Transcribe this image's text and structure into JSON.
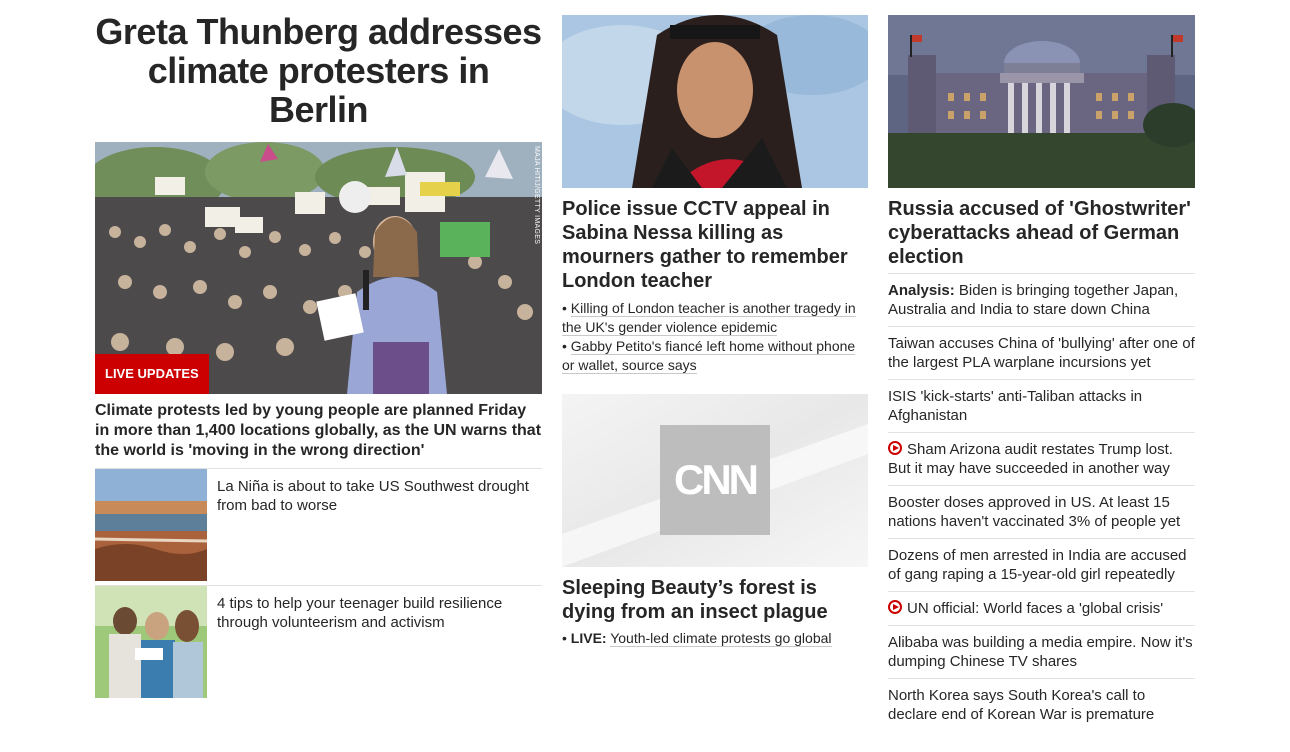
{
  "hero": {
    "title": "Greta Thunberg addresses climate protesters in Berlin",
    "badge": "LIVE UPDATES",
    "photo_credit": "MAJA HITIJ/GETTY IMAGES",
    "summary": "Climate protests led by young people are planned Friday in more than 1,400 locations globally, as the UN warns that the world is 'moving in the wrong direction'"
  },
  "side_items": [
    {
      "text": "La Niña is about to take US Southwest drought from bad to worse"
    },
    {
      "text": "4 tips to help your teenager build resilience through volunteerism and activism"
    }
  ],
  "col2": {
    "card1": {
      "title": "Police issue CCTV appeal in Sabina Nessa killing as mourners gather to remember London teacher",
      "bullets": [
        "Killing of London teacher is another tragedy in the UK's gender violence epidemic",
        "Gabby Petito's fiancé left home without phone or wallet, source says"
      ]
    },
    "card2": {
      "logo_text": "CNN",
      "title": "Sleeping Beauty’s forest is dying from an insect plague",
      "live_label": "LIVE:",
      "live_text": "Youth-led climate protests go global"
    }
  },
  "col3": {
    "title": "Russia accused of 'Ghostwriter' cyberattacks ahead of German election",
    "list": [
      {
        "prefix": "Analysis:",
        "text": "Biden is bringing together Japan, Australia and India to stare down China",
        "video": false
      },
      {
        "prefix": "",
        "text": "Taiwan accuses China of 'bullying' after one of the largest PLA warplane incursions yet",
        "video": false
      },
      {
        "prefix": "",
        "text": "ISIS 'kick-starts' anti-Taliban attacks in Afghanistan",
        "video": false
      },
      {
        "prefix": "",
        "text": "Sham Arizona audit restates Trump lost. But it may have succeeded in another way",
        "video": true
      },
      {
        "prefix": "",
        "text": "Booster doses approved in US. At least 15 nations haven't vaccinated 3% of people yet",
        "video": false
      },
      {
        "prefix": "",
        "text": "Dozens of men arrested in India are accused of gang raping a 15-year-old girl repeatedly",
        "video": false
      },
      {
        "prefix": "",
        "text": "UN official: World faces a 'global crisis'",
        "video": true
      },
      {
        "prefix": "",
        "text": "Alibaba was building a media empire. Now it's dumping Chinese TV shares",
        "video": false
      },
      {
        "prefix": "",
        "text": "North Korea says South Korea's call to declare end of Korean War is premature",
        "video": false
      }
    ]
  },
  "colors": {
    "accent_red": "#cc0000",
    "text": "#262626",
    "divider": "#e2e2e2"
  }
}
